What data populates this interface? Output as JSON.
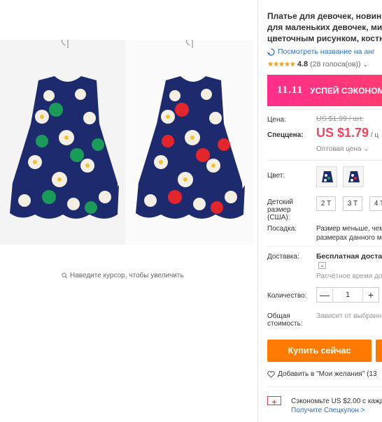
{
  "gallery": {
    "zoom_hint": "Наведите курсор, чтобы увеличить"
  },
  "product": {
    "title_lines": [
      "Платье для девочек, новинк",
      "для маленьких девочек, мил",
      "цветочным рисунком, костю"
    ],
    "translate_link": "Посмотреть название на анг",
    "rating": {
      "stars": "★★★★★",
      "value": "4.8",
      "count": "(28 голоса(ов))"
    }
  },
  "promo": {
    "logo": "11.11",
    "text": "УСПЕЙ СЭКОНОМИ"
  },
  "price": {
    "label": "Цена:",
    "old_value": "US $1.99",
    "old_unit": " / шт.",
    "sale_label": "Спеццена:",
    "sale_value": "US $1.79",
    "sale_unit": " / ц",
    "wholesale": "Оптовая цена",
    "wholesale_arrow": "⌄"
  },
  "options": {
    "color_label": "Цвет:",
    "size_label_lines": [
      "Детский",
      "размер",
      "(США):"
    ],
    "sizes": [
      "2 T",
      "3 T",
      "4 T"
    ],
    "fit_label": "Посадка:",
    "fit_lines": [
      "Размер меньше, чем",
      "размерах данного м"
    ]
  },
  "shipping": {
    "label": "Доставка:",
    "value": "Бесплатная достав",
    "toggle": "⌄",
    "time": "Расчётное время дос"
  },
  "quantity": {
    "label": "Количество:",
    "value": "1",
    "minus": "—",
    "plus": "+"
  },
  "total": {
    "label_lines": [
      "Общая",
      "стоимость:"
    ],
    "note": "Зависит от выбранн"
  },
  "actions": {
    "buy_now": "Купить сейчас",
    "wishlist": "Добавить в \"Мои желания\" (13"
  },
  "coupon": {
    "text": "Сэкономьте US $2.00 с кажд",
    "link": "Получите Спецкупон >"
  },
  "colors": {
    "accent_red": "#f5455d",
    "buy_orange": "#ff7a00",
    "promo_pink": "#ff2f8b",
    "link_blue": "#2e6ec7",
    "star": "#ff9900"
  }
}
